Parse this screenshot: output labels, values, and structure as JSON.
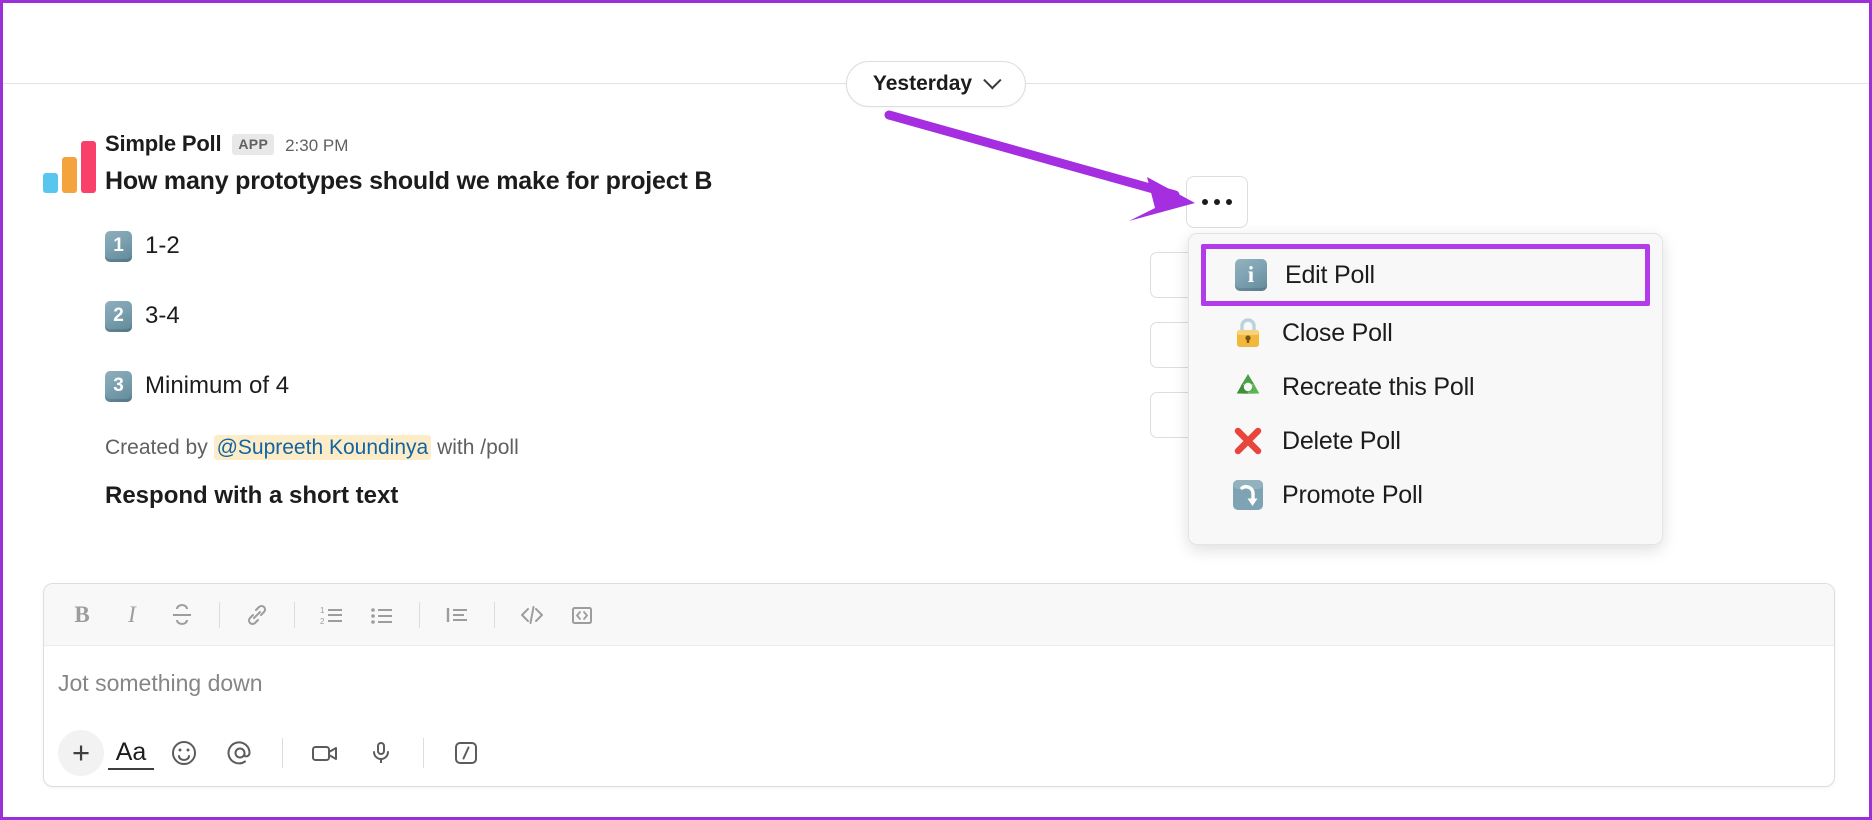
{
  "theme": {
    "accent_purple": "#b23bea",
    "arrow_purple": "#a42ee0",
    "frame_purple": "#9b30d9",
    "text_primary": "#1d1c1d",
    "text_secondary": "#616061",
    "mention_bg": "#fdecc8",
    "mention_text": "#1264a3",
    "menu_bg": "#f8f8f8"
  },
  "date_divider": {
    "label": "Yesterday",
    "chevron_icon": "chevron-down-icon"
  },
  "message": {
    "app_logo_icon": "bar-chart-logo-icon",
    "author": "Simple Poll",
    "app_badge": "APP",
    "timestamp": "2:30 PM",
    "question": "How many prototypes should we make for project B",
    "options": [
      {
        "number": "1",
        "label": "1-2"
      },
      {
        "number": "2",
        "label": "3-4"
      },
      {
        "number": "3",
        "label": "Minimum of 4"
      }
    ],
    "footer": {
      "prefix": "Created by",
      "mention": "@Supreeth Koundinya",
      "suffix": "with /poll"
    }
  },
  "next_message": {
    "text": "Respond with a short text"
  },
  "overflow_button": {
    "icon": "more-options-icon",
    "label": "More actions"
  },
  "context_menu": {
    "items": [
      {
        "icon": "info-square-icon",
        "glyph": "i",
        "label": "Edit Poll",
        "highlighted": true
      },
      {
        "icon": "lock-icon",
        "glyph": "🔒",
        "label": "Close Poll",
        "highlighted": false
      },
      {
        "icon": "recycle-icon",
        "glyph": "♻️",
        "label": "Recreate this Poll",
        "highlighted": false
      },
      {
        "icon": "cross-mark-icon",
        "glyph": "❌",
        "label": "Delete Poll",
        "highlighted": false
      },
      {
        "icon": "arrow-down-square-icon",
        "glyph": "⤵",
        "label": "Promote Poll",
        "highlighted": false
      }
    ]
  },
  "composer": {
    "placeholder": "Jot something down",
    "format_buttons": [
      {
        "name": "bold-button",
        "label": "B"
      },
      {
        "name": "italic-button",
        "label": "I"
      },
      {
        "name": "strikethrough-button",
        "label": "S"
      },
      {
        "name": "link-button",
        "label": ""
      },
      {
        "name": "ordered-list-button",
        "label": ""
      },
      {
        "name": "bulleted-list-button",
        "label": ""
      },
      {
        "name": "blockquote-button",
        "label": ""
      },
      {
        "name": "code-button",
        "label": ""
      },
      {
        "name": "code-block-button",
        "label": ""
      }
    ],
    "action_buttons": [
      {
        "name": "attachment-button",
        "label": "+"
      },
      {
        "name": "formatting-button",
        "label": "Aa"
      },
      {
        "name": "emoji-button",
        "label": ""
      },
      {
        "name": "mention-button",
        "label": "@"
      },
      {
        "name": "video-button",
        "label": ""
      },
      {
        "name": "audio-button",
        "label": ""
      },
      {
        "name": "slash-command-button",
        "label": ""
      }
    ]
  }
}
